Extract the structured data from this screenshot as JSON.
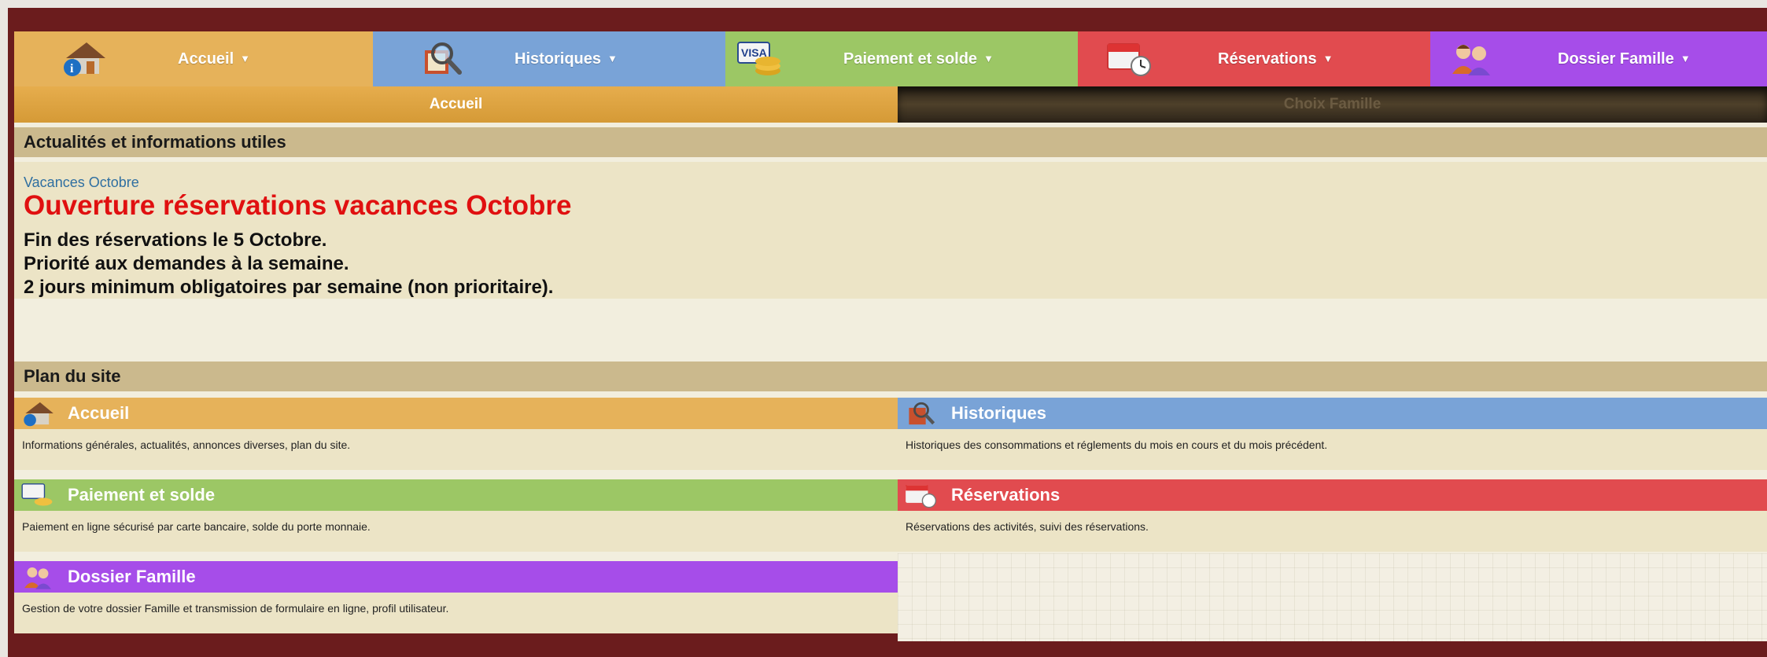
{
  "topnav": {
    "tabs": [
      {
        "label": "Accueil",
        "color": "#e6b25a",
        "icon": "house-info-icon"
      },
      {
        "label": "Historiques",
        "color": "#79a3d7",
        "icon": "magnifier-book-icon"
      },
      {
        "label": "Paiement et solde",
        "color": "#9cc765",
        "icon": "visa-coins-icon"
      },
      {
        "label": "Réservations",
        "color": "#e14b4f",
        "icon": "calendar-clock-icon"
      },
      {
        "label": "Dossier Famille",
        "color": "#a64de9",
        "icon": "family-icon"
      }
    ],
    "caret": "▼"
  },
  "subnav": {
    "active": "Accueil",
    "inactive": "Choix Famille"
  },
  "sections": {
    "news_header": "Actualités et informations utiles",
    "sitemap_header": "Plan du site"
  },
  "news": {
    "tag": "Vacances Octobre",
    "title": "Ouverture réservations vacances Octobre",
    "lines": [
      "Fin des réservations le 5 Octobre.",
      "Priorité aux demandes à la semaine.",
      "2 jours minimum obligatoires par semaine (non prioritaire)."
    ]
  },
  "sitemap": [
    {
      "title": "Accueil",
      "desc": "Informations générales, actualités, annonces diverses, plan du site.",
      "color": "#e6b25a"
    },
    {
      "title": "Historiques",
      "desc": "Historiques des consommations et réglements du mois en cours et du mois précédent.",
      "color": "#79a3d7"
    },
    {
      "title": "Paiement et solde",
      "desc": "Paiement en ligne sécurisé par carte bancaire, solde du porte monnaie.",
      "color": "#9cc765"
    },
    {
      "title": "Réservations",
      "desc": "Réservations des activités, suivi des réservations.",
      "color": "#e14b4f"
    },
    {
      "title": "Dossier Famille",
      "desc": "Gestion de votre dossier Famille et transmission de formulaire en ligne, profil utilisateur.",
      "color": "#a64de9"
    }
  ]
}
